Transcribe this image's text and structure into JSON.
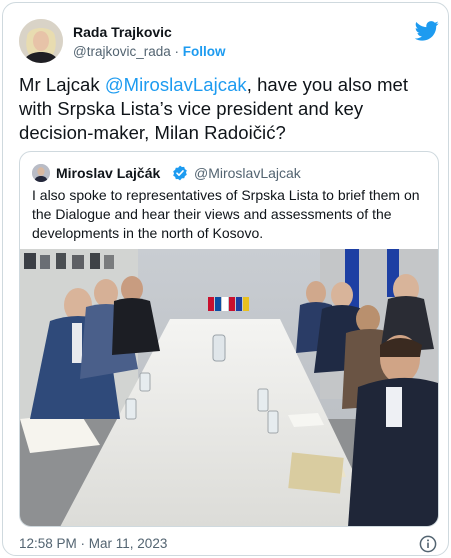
{
  "author": {
    "name": "Rada Trajkovic",
    "handle": "@trajkovic_rada",
    "separator": "·",
    "follow_label": "Follow"
  },
  "tweet": {
    "text_prefix": "Mr Lajcak ",
    "mention": "@MiroslavLajcak",
    "text_suffix": ", have you also met with Srpska Lista’s vice president and key decision-maker, Milan Radoičić?"
  },
  "quoted": {
    "name": "Miroslav Lajčák",
    "handle": "@MiroslavLajcak",
    "text": "I also spoke to representatives of Srpska Lista to brief them on the Dialogue and hear their views and assessments of the developments in the north of Kosovo."
  },
  "footer": {
    "timestamp": "12:58 PM · Mar 11, 2023"
  },
  "colors": {
    "link": "#1d9bf0",
    "text": "#0f1419",
    "secondary": "#536471",
    "border": "#cfd9de"
  },
  "icons": [
    "twitter-bird-icon",
    "verified-badge-icon",
    "info-icon"
  ]
}
